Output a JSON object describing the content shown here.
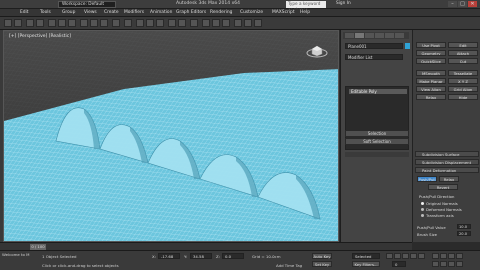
{
  "titlebar": {
    "workspace": "Workspace: Default",
    "title": "Autodesk 3ds Max 2014 x64",
    "search_placeholder": "Type a keyword or phrase",
    "user": "Sign In",
    "min": "–",
    "max": "□",
    "close": "✕"
  },
  "menubar": {
    "items": [
      "Edit",
      "Tools",
      "Group",
      "Views",
      "Create",
      "Modifiers",
      "Animation",
      "Graph Editors",
      "Rendering",
      "Customize",
      "MAXScript",
      "Help"
    ]
  },
  "viewport": {
    "label": "[+] [Perspective] [Realistic]",
    "mesh_color": "#7fd1e6"
  },
  "command_panel": {
    "object_name": "Plane001",
    "modifier_list": "Modifier List",
    "stack": [
      "Editable Poly"
    ],
    "object_color": "#2fa3d6",
    "rollouts": [
      "Selection",
      "Soft Selection"
    ]
  },
  "graphite": {
    "buttons": [
      [
        "Use Pivot",
        "Edit"
      ],
      [
        "Geometry",
        "Attach"
      ],
      [
        "QuickSlice",
        "Cut"
      ],
      [
        "MSmooth",
        "Tessellate"
      ],
      [
        "Make Planar",
        "X Y Z"
      ],
      [
        "View Align",
        "Grid Align"
      ],
      [
        "Relax",
        "Hide"
      ]
    ],
    "subdivision_surface": "Subdivision Surface",
    "subdivision_displacement": "Subdivision Displacement",
    "paint_deformation": "Paint Deformation",
    "paint_buttons": [
      "Push/Pull",
      "Relax",
      "Revert"
    ],
    "pushpull_direction": "Push/Pull Direction",
    "options": [
      "Original Normals",
      "Deformed Normals",
      "Transform axis"
    ],
    "pushpull_value_label": "Push/Pull Value",
    "pushpull_value": "10.0",
    "brush_size_label": "Brush Size",
    "brush_size": "20.0",
    "brush_strength_label": "Brush Strength",
    "brush_strength": "1.0"
  },
  "timeline": {
    "slider": "0 / 100"
  },
  "statusbar": {
    "selected": "1 Object Selected",
    "prompt": "Click or click-and-drag to select objects",
    "welcome": "Welcome to M",
    "x_label": "X:",
    "x": "-17.68",
    "y_label": "Y:",
    "y": "34.58",
    "z_label": "Z:",
    "z": "0.0",
    "grid": "Grid = 10.0cm",
    "auto_key": "Auto Key",
    "selected_dropdown": "Selected",
    "set_key": "Set Key",
    "key_filters": "Key Filters...",
    "add_time_tag": "Add Time Tag",
    "frame": "0"
  }
}
